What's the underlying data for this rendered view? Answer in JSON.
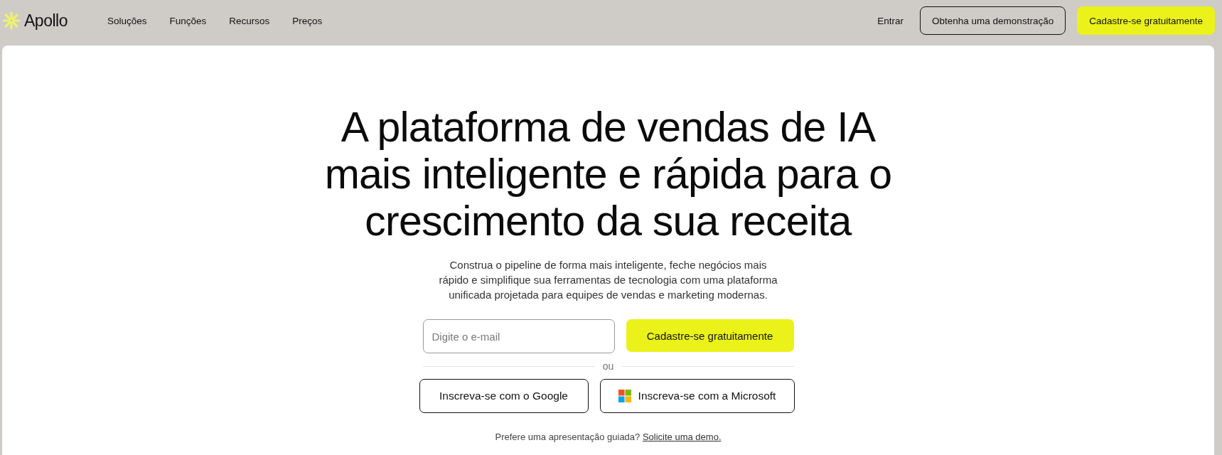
{
  "nav": {
    "logo": "Apollo",
    "links": [
      "Soluções",
      "Funções",
      "Recursos",
      "Preços"
    ],
    "login": "Entrar",
    "demo_button": "Obtenha uma demonstração",
    "signup_button": "Cadastre-se gratuitamente"
  },
  "hero": {
    "headline": "A plataforma de vendas de IA mais inteligente e rápida para o crescimento da sua receita",
    "subtitle": "Construa o pipeline de forma mais inteligente, feche negócios mais rápido e simplifique sua ferramentas de tecnologia com uma plataforma unificada projetada para equipes de vendas e marketing modernas.",
    "email_field": {
      "placeholder": "Digite o e-mail"
    },
    "signup_button": "Cadastre-se gratuitamente",
    "divider": "ou",
    "social_buttons": [
      {
        "kind": "google",
        "label": "Inscreva-se com o Google"
      },
      {
        "kind": "microsoft",
        "label": "Inscreva-se com a Microsoft"
      }
    ],
    "guided_text": "Prefere uma apresentação guiada?",
    "demo_link": "Solicite uma demo."
  }
}
